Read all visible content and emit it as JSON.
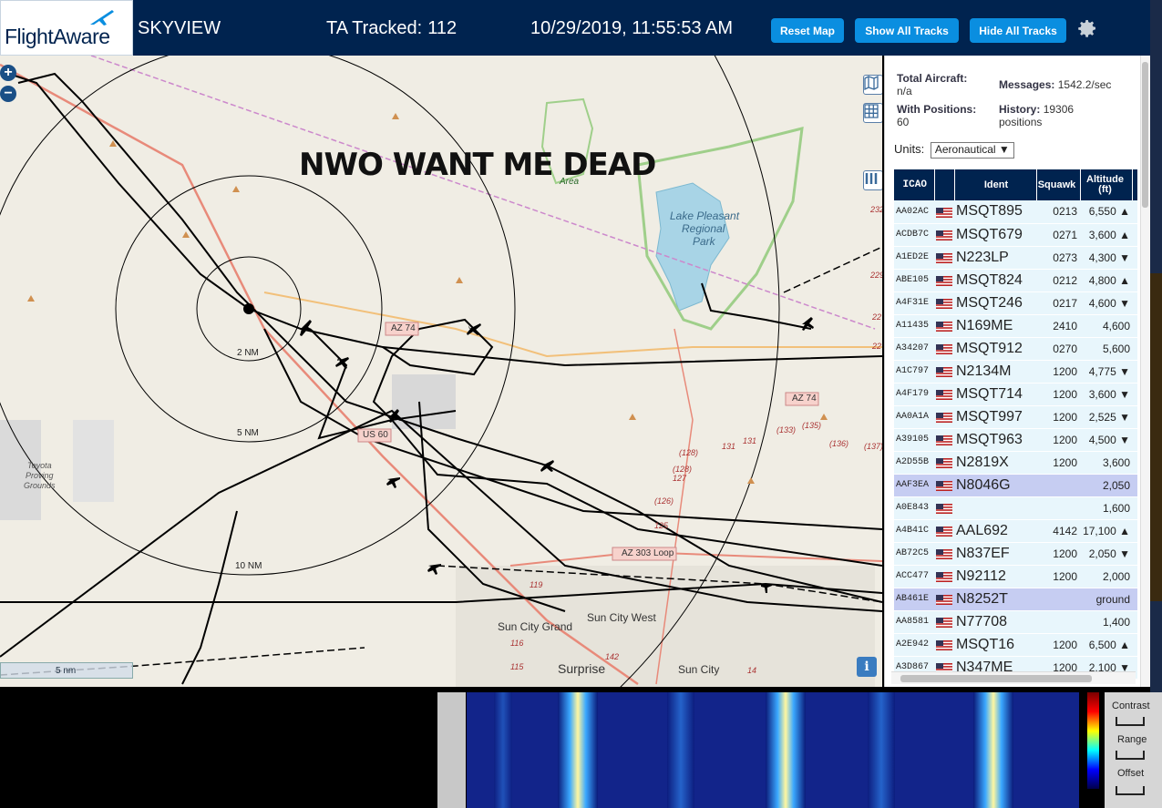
{
  "header": {
    "logo_text": "FlightAware",
    "app_name": "SKYVIEW",
    "tracked_label": "TA Tracked:",
    "tracked_count": "112",
    "datetime": "10/29/2019, 11:55:53 AM",
    "buttons": {
      "reset": "Reset Map",
      "show_all": "Show All Tracks",
      "hide_all": "Hide All Tracks"
    },
    "accent_color": "#0a8ee0",
    "bar_color": "#00234f"
  },
  "map": {
    "overlay_text": "NWO WANT ME DEAD",
    "zoom_in": "+",
    "zoom_out": "−",
    "range_labels": [
      "2 NM",
      "5 NM",
      "10 NM"
    ],
    "places": [
      "Lake Pleasant",
      "Regional",
      "Park",
      "Sun City Grand",
      "Sun City West",
      "Surprise",
      "Sun City",
      "Toyota",
      "Proving",
      "Grounds",
      "Area"
    ],
    "roads": [
      "AZ 74",
      "AZ 74",
      "US 60",
      "AZ 303 Loop"
    ],
    "road_numbers": [
      "(128)",
      "(128)",
      "127",
      "131",
      "131",
      "(133)",
      "(135)",
      "(136)",
      "(137)",
      "(126)",
      "125",
      "119",
      "116",
      "115",
      "142",
      "14",
      "229",
      "22",
      "232",
      "22"
    ],
    "scale_label": "5 nm",
    "info": "i"
  },
  "panel": {
    "total_aircraft_label": "Total Aircraft:",
    "total_aircraft_value": "n/a",
    "messages_label": "Messages:",
    "messages_value": "1542.2/sec",
    "with_positions_label": "With Positions:",
    "with_positions_value": "60",
    "history_label": "History:",
    "history_value": "19306",
    "history_unit": "positions",
    "units_label": "Units:",
    "units_value": "Aeronautical ▼",
    "table": {
      "headers": [
        "ICAO",
        "",
        "Ident",
        "Squawk",
        "Altitude",
        "(ft)"
      ],
      "rows": [
        {
          "icao": "AA02AC",
          "ident": "MSQT895",
          "squawk": "0213",
          "alt": "6,550 ▲",
          "sel": false
        },
        {
          "icao": "ACDB7C",
          "ident": "MSQT679",
          "squawk": "0271",
          "alt": "3,600 ▲",
          "sel": false
        },
        {
          "icao": "A1ED2E",
          "ident": "N223LP",
          "squawk": "0273",
          "alt": "4,300 ▼",
          "sel": false
        },
        {
          "icao": "ABE105",
          "ident": "MSQT824",
          "squawk": "0212",
          "alt": "4,800 ▲",
          "sel": false
        },
        {
          "icao": "A4F31E",
          "ident": "MSQT246",
          "squawk": "0217",
          "alt": "4,600 ▼",
          "sel": false
        },
        {
          "icao": "A11435",
          "ident": "N169ME",
          "squawk": "2410",
          "alt": "4,600",
          "sel": false
        },
        {
          "icao": "A34207",
          "ident": "MSQT912",
          "squawk": "0270",
          "alt": "5,600",
          "sel": false
        },
        {
          "icao": "A1C797",
          "ident": "N2134M",
          "squawk": "1200",
          "alt": "4,775 ▼",
          "sel": false
        },
        {
          "icao": "A4F179",
          "ident": "MSQT714",
          "squawk": "1200",
          "alt": "3,600 ▼",
          "sel": false
        },
        {
          "icao": "AA0A1A",
          "ident": "MSQT997",
          "squawk": "1200",
          "alt": "2,525 ▼",
          "sel": false
        },
        {
          "icao": "A39105",
          "ident": "MSQT963",
          "squawk": "1200",
          "alt": "4,500 ▼",
          "sel": false
        },
        {
          "icao": "A2D55B",
          "ident": "N2819X",
          "squawk": "1200",
          "alt": "3,600",
          "sel": false
        },
        {
          "icao": "AAF3EA",
          "ident": "N8046G",
          "squawk": "",
          "alt": "2,050",
          "sel": true
        },
        {
          "icao": "A0E843",
          "ident": "",
          "squawk": "",
          "alt": "1,600",
          "sel": false
        },
        {
          "icao": "A4B41C",
          "ident": "AAL692",
          "squawk": "4142",
          "alt": "17,100 ▲",
          "sel": false
        },
        {
          "icao": "AB72C5",
          "ident": "N837EF",
          "squawk": "1200",
          "alt": "2,050 ▼",
          "sel": false
        },
        {
          "icao": "ACC477",
          "ident": "N92112",
          "squawk": "1200",
          "alt": "2,000",
          "sel": false
        },
        {
          "icao": "AB461E",
          "ident": "N8252T",
          "squawk": "",
          "alt": "ground",
          "sel": true
        },
        {
          "icao": "AA8581",
          "ident": "N77708",
          "squawk": "",
          "alt": "1,400",
          "sel": false
        },
        {
          "icao": "A2E942",
          "ident": "MSQT16",
          "squawk": "1200",
          "alt": "6,500 ▲",
          "sel": false
        },
        {
          "icao": "A3D867",
          "ident": "N347ME",
          "squawk": "1200",
          "alt": "2,100 ▼",
          "sel": false
        }
      ]
    }
  },
  "spectrum": {
    "contrast_label": "Contrast",
    "range_label": "Range",
    "offset_label": "Offset"
  }
}
